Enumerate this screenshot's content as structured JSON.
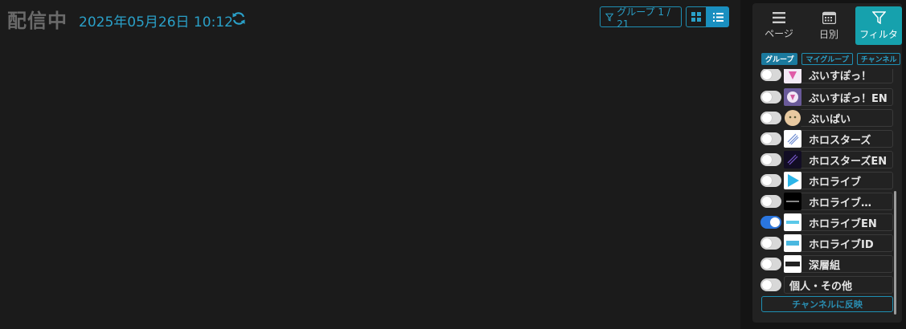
{
  "header": {
    "title": "配信中",
    "datetime": "2025年05月26日 10:12",
    "group_button_label": "グループ 1 / 21"
  },
  "panel": {
    "tabs": [
      {
        "label": "ページ",
        "icon": "hamburger-icon"
      },
      {
        "label": "日別",
        "icon": "calendar-icon"
      },
      {
        "label": "フィルタ",
        "icon": "filter-icon"
      }
    ],
    "subtabs": [
      "グループ",
      "マイグループ",
      "チャンネル"
    ],
    "groups": [
      {
        "name": "ぶいすぽっ！",
        "enabled": false
      },
      {
        "name": "ぶいすぽっ！EN",
        "enabled": false
      },
      {
        "name": "ぶいぱい",
        "enabled": false
      },
      {
        "name": "ホロスターズ",
        "enabled": false
      },
      {
        "name": "ホロスターズEN",
        "enabled": false
      },
      {
        "name": "ホロライブ",
        "enabled": false
      },
      {
        "name": "ホロライブ…",
        "enabled": false
      },
      {
        "name": "ホロライブEN",
        "enabled": true
      },
      {
        "name": "ホロライブID",
        "enabled": false
      },
      {
        "name": "深層組",
        "enabled": false
      },
      {
        "name": "個人・その他",
        "enabled": false
      }
    ],
    "apply_label": "チャンネルに反映"
  },
  "colors": {
    "accent": "#16a1ad",
    "link": "#2aa0c8",
    "toggle_on": "#2a76e0"
  }
}
